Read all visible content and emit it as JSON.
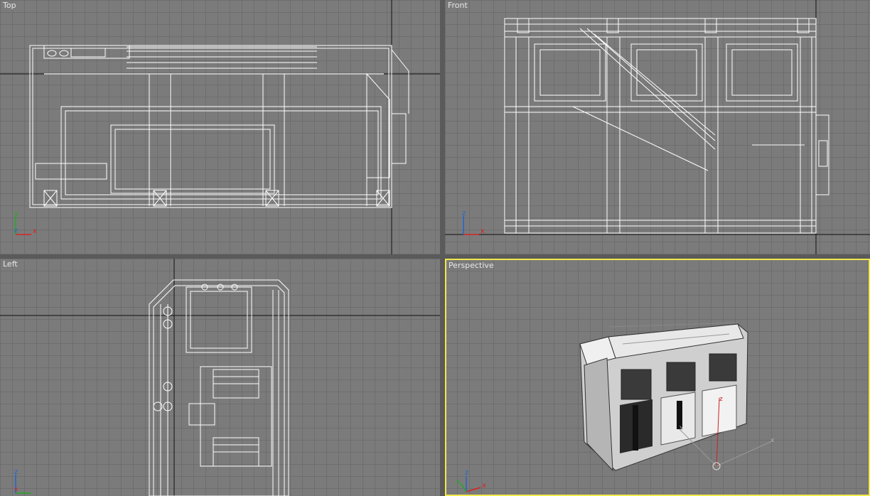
{
  "viewports": {
    "top": {
      "label": "Top"
    },
    "front": {
      "label": "Front"
    },
    "left": {
      "label": "Left"
    },
    "perspective": {
      "label": "Perspective"
    }
  },
  "colors": {
    "background": "#7b7b7b",
    "grid": "#6e6e6e",
    "wire": "#ffffff",
    "active_border": "#f2e84b"
  },
  "axis_labels": {
    "x": "x",
    "y": "y",
    "z": "z"
  }
}
